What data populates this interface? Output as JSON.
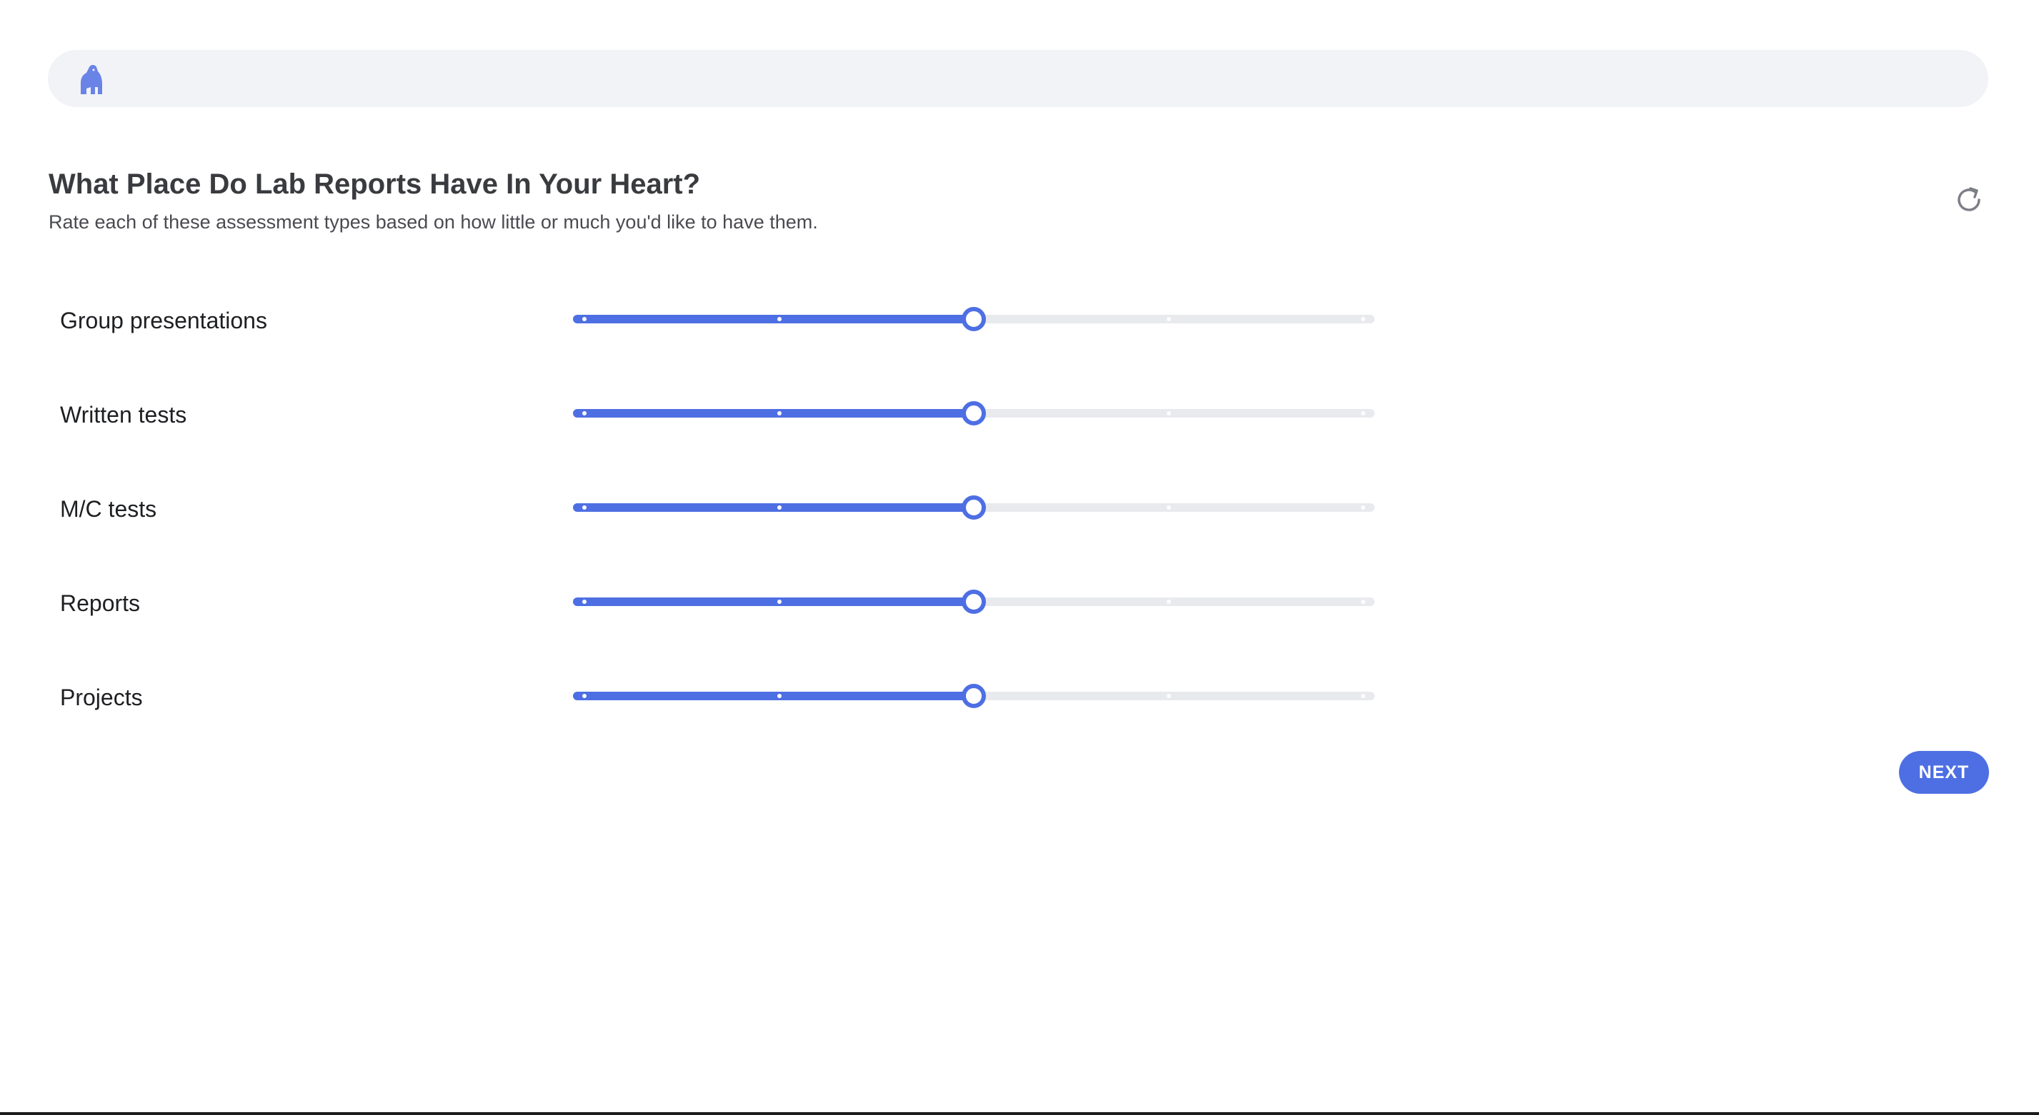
{
  "header": {
    "logo_icon": "gorilla-logo-icon"
  },
  "question": {
    "title": "What Place Do Lab Reports Have In Your Heart?",
    "subtitle": "Rate each of these assessment types based on how little or much you'd like to have them.",
    "reset_icon": "refresh-icon"
  },
  "scale": {
    "min": 1,
    "max": 5,
    "steps": 5
  },
  "rows": [
    {
      "label": "Group presentations",
      "value": 3
    },
    {
      "label": "Written tests",
      "value": 3
    },
    {
      "label": "M/C tests",
      "value": 3
    },
    {
      "label": "Reports",
      "value": 3
    },
    {
      "label": "Projects",
      "value": 3
    }
  ],
  "footer": {
    "next_label": "NEXT"
  },
  "colors": {
    "accent": "#4e6fe3",
    "track": "#e9eaee",
    "topbar": "#f2f3f6"
  }
}
